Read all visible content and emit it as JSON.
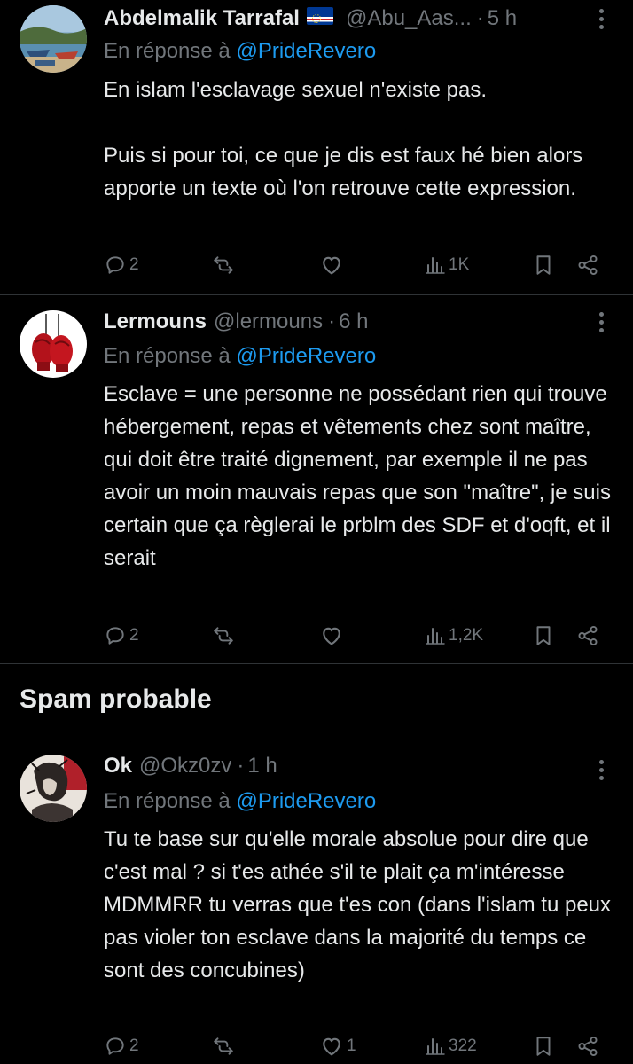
{
  "colors": {
    "background": "#000000",
    "text": "#e7e9ea",
    "muted": "#71767b",
    "link": "#1d9bf0",
    "divider": "#2f3336"
  },
  "tweets": [
    {
      "name": "Abdelmalik Tarrafal",
      "flag": "cape-verde-flag",
      "handle": "@Abu_Aas...",
      "time": "5 h",
      "reply_prefix": "En réponse à",
      "reply_to": "@PrideRevero",
      "paragraphs": [
        "En islam l'esclavage sexuel n'existe pas.",
        "Puis si pour toi, ce que je dis est faux hé bien alors apporte un texte où l'on retrouve cette expression."
      ],
      "replies": "2",
      "reposts": "",
      "likes": "",
      "views": "1K"
    },
    {
      "name": "Lermouns",
      "handle": "@lermouns",
      "time": "6 h",
      "reply_prefix": "En réponse à",
      "reply_to": "@PrideRevero",
      "paragraphs": [
        "Esclave = une personne ne possédant rien qui trouve hébergement, repas et vêtements chez sont maître, qui doit être traité dignement, par exemple il ne pas avoir un moin mauvais repas que son \"maître\", je suis certain que ça règlerai le prblm des SDF et d'oqft, et il serait"
      ],
      "replies": "2",
      "reposts": "",
      "likes": "",
      "views": "1,2K"
    },
    {
      "name": "Ok",
      "handle": "@Okz0zv",
      "time": "1 h",
      "reply_prefix": "En réponse à",
      "reply_to": "@PrideRevero",
      "paragraphs": [
        "Tu te base sur qu'elle morale absolue pour dire que c'est mal ? si t'es athée s'il te plait ça m'intéresse MDMMRR tu verras que t'es con (dans l'islam tu peux pas violer ton esclave dans la majorité du temps ce sont des concubines)"
      ],
      "replies": "2",
      "reposts": "",
      "likes": "1",
      "views": "322"
    }
  ],
  "section": {
    "title": "Spam probable"
  },
  "separator": "·"
}
